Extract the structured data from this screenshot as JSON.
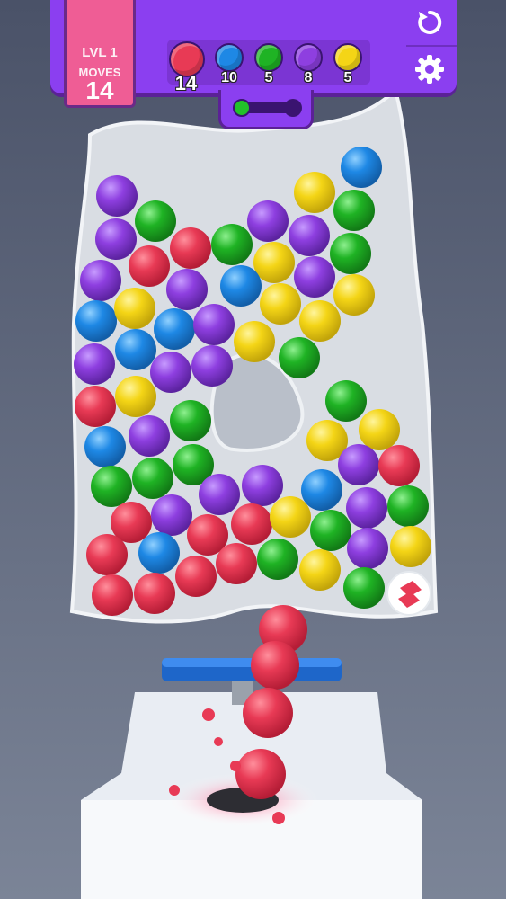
{
  "hud": {
    "level": "LVL 1",
    "moves_label": "MOVES",
    "moves_value": "14"
  },
  "goals": [
    {
      "color": "red",
      "hex": "#e83a55",
      "count": "14"
    },
    {
      "color": "blue",
      "hex": "#1e88e5",
      "count": "10"
    },
    {
      "color": "green",
      "hex": "#1fb324",
      "count": "5"
    },
    {
      "color": "purple",
      "hex": "#8e3fe0",
      "count": "8"
    },
    {
      "color": "yellow",
      "hex": "#f4d516",
      "count": "5"
    }
  ],
  "controls": {
    "restart_icon": "restart-icon",
    "settings_icon": "gear-icon"
  },
  "colors": {
    "panel": "#8b3ff0",
    "level_panel": "#ef5d95",
    "ball_red": "#e83a55",
    "ball_blue": "#1e88e5",
    "ball_green": "#1fb324",
    "ball_purple": "#8e3fe0",
    "ball_yellow": "#f4d516"
  }
}
